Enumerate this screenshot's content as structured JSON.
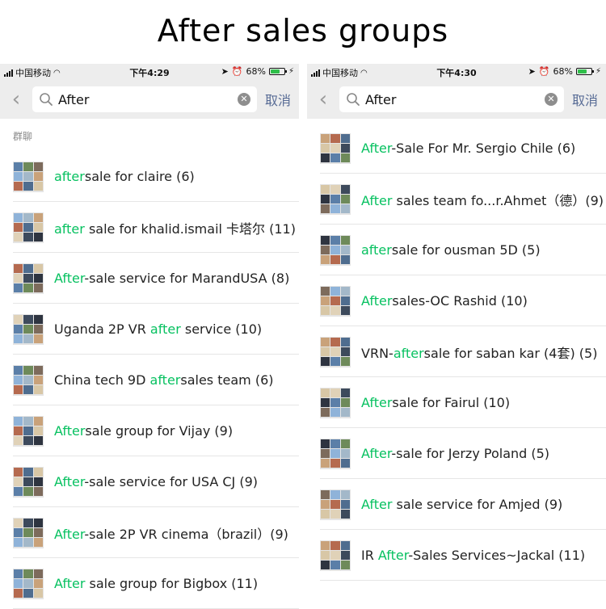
{
  "page_title": "After sales groups",
  "colors": {
    "highlight": "#07c160",
    "cancel": "#576b95",
    "bar_bg": "#ededed"
  },
  "panels": [
    {
      "status": {
        "carrier": "中国移动",
        "time": "下午4:29",
        "battery": "68%",
        "battery_level": 0.68
      },
      "search": {
        "query": "After",
        "cancel_label": "取消"
      },
      "section_label": "群聊",
      "groups": [
        {
          "pre": "",
          "hl": "after",
          "post": "sale for claire (6)"
        },
        {
          "pre": "",
          "hl": "after",
          "post": " sale for khalid.ismail 卡塔尔 (11)"
        },
        {
          "pre": "",
          "hl": "After",
          "post": "-sale service for MarandUSA (8)"
        },
        {
          "pre": "Uganda 2P VR ",
          "hl": "after",
          "post": " service (10)"
        },
        {
          "pre": "China tech 9D ",
          "hl": "after",
          "post": "sales team (6)"
        },
        {
          "pre": "",
          "hl": "After",
          "post": "sale group for Vijay (9)"
        },
        {
          "pre": "",
          "hl": "After",
          "post": "-sale service for USA CJ (9)"
        },
        {
          "pre": "",
          "hl": "After",
          "post": "-sale 2P VR cinema（brazil）(9)"
        },
        {
          "pre": "",
          "hl": "After",
          "post": " sale group for Bigbox (11)"
        }
      ]
    },
    {
      "status": {
        "carrier": "中国移动",
        "time": "下午4:30",
        "battery": "68%",
        "battery_level": 0.68
      },
      "search": {
        "query": "After",
        "cancel_label": "取消"
      },
      "groups": [
        {
          "pre": "",
          "hl": "After",
          "post": "-Sale For Mr. Sergio Chile (6)"
        },
        {
          "pre": "",
          "hl": "After",
          "post": " sales team fo...r.Ahmet（德）(9)"
        },
        {
          "pre": "",
          "hl": "after",
          "post": "sale for ousman 5D (5)"
        },
        {
          "pre": "",
          "hl": "After",
          "post": "sales-OC Rashid (10)"
        },
        {
          "pre": "VRN-",
          "hl": "after",
          "post": "sale for saban kar (4套) (5)"
        },
        {
          "pre": "",
          "hl": "After",
          "post": "sale for Fairul (10)"
        },
        {
          "pre": "",
          "hl": "After",
          "post": "-sale for Jerzy Poland (5)"
        },
        {
          "pre": "",
          "hl": "After",
          "post": " sale service for Amjed (9)"
        },
        {
          "pre": "IR ",
          "hl": "After",
          "post": "-Sales Services~Jackal (11)"
        }
      ]
    }
  ]
}
